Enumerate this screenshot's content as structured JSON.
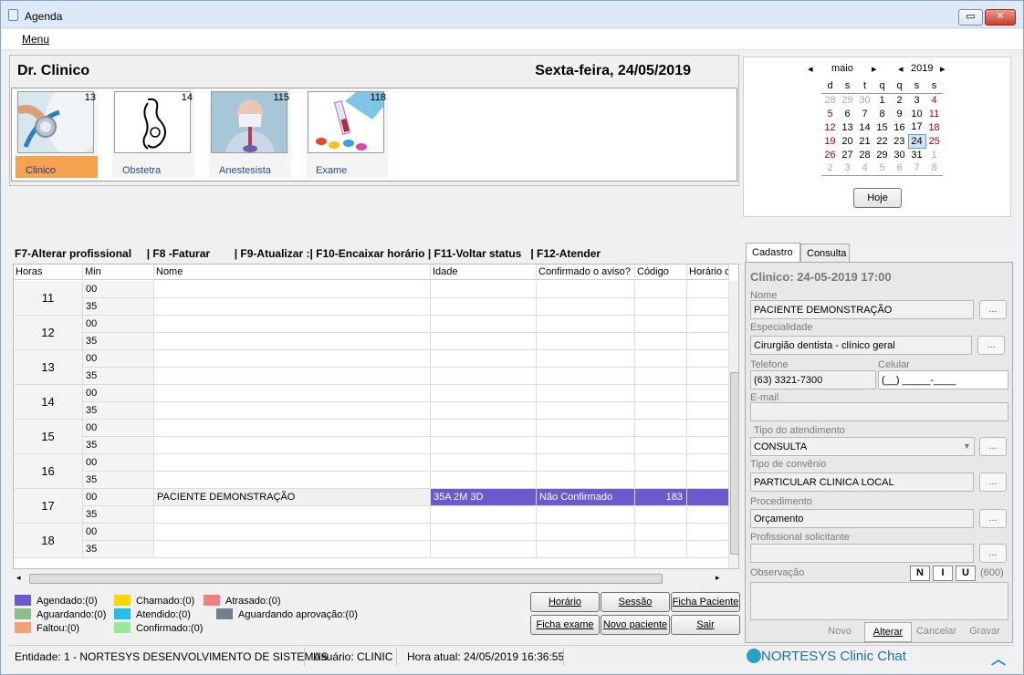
{
  "window": {
    "title": "Agenda",
    "min_glyph": "▭",
    "close_glyph": "✕"
  },
  "menu": {
    "label": "Menu"
  },
  "header": {
    "doctor": "Dr. Clinico",
    "date": "Sexta-feira, 24/05/2019"
  },
  "specialties": [
    {
      "label": "Clinico",
      "count": "13",
      "icon": "stethoscope-icon",
      "selected": true
    },
    {
      "label": "Obstetra",
      "count": "14",
      "icon": "pregnancy-icon",
      "selected": false
    },
    {
      "label": "Anestesista",
      "count": "115",
      "icon": "anesthetist-icon",
      "selected": false
    },
    {
      "label": "Exame",
      "count": "118",
      "icon": "blood-sample-icon",
      "selected": false
    }
  ],
  "calendar": {
    "month": "maio",
    "year": "2019",
    "weekdays": [
      "d",
      "s",
      "t",
      "q",
      "q",
      "s",
      "s"
    ],
    "weeks": [
      [
        "28",
        "29",
        "30",
        "1",
        "2",
        "3",
        "4"
      ],
      [
        "5",
        "6",
        "7",
        "8",
        "9",
        "10",
        "11"
      ],
      [
        "12",
        "13",
        "14",
        "15",
        "16",
        "17",
        "18"
      ],
      [
        "19",
        "20",
        "21",
        "22",
        "23",
        "24",
        "25"
      ],
      [
        "26",
        "27",
        "28",
        "29",
        "30",
        "31",
        "1"
      ],
      [
        "2",
        "3",
        "4",
        "5",
        "6",
        "7",
        "8"
      ]
    ],
    "today_label": "Hoje"
  },
  "shortcuts": "F7-Alterar profissional     | F8 -Faturar        | F9-Atualizar :| F10-Encaixar horário | F11-Voltar status   | F12-Atender",
  "grid": {
    "columns": [
      "Horas",
      "Min",
      "Nome",
      "Idade",
      "Confirmado o aviso?",
      "Código",
      "Horário c"
    ],
    "hours": [
      "11",
      "12",
      "13",
      "14",
      "15",
      "16",
      "17",
      "18"
    ],
    "minutes": [
      "00",
      "35"
    ],
    "appointment": {
      "hour": "17",
      "min": "00",
      "nome": "PACIENTE DEMONSTRAÇÃO",
      "idade": "35A 2M 3D",
      "confirmado": "Não Confirmado",
      "codigo": "183"
    }
  },
  "legend": [
    {
      "label": "Agendado:(0)",
      "color": "#6a5acd"
    },
    {
      "label": "Aguardando:(0)",
      "color": "#8fbc8f"
    },
    {
      "label": "Faltou:(0)",
      "color": "#f4a07a"
    },
    {
      "label": "Chamado:(0)",
      "color": "#ffd700"
    },
    {
      "label": "Atendido:(0)",
      "color": "#1ec0f0"
    },
    {
      "label": "Confirmado:(0)",
      "color": "#98e898"
    },
    {
      "label": "Atrasado:(0)",
      "color": "#f08080"
    },
    {
      "label": "Aguardando aprovação:(0)",
      "color": "#708090"
    }
  ],
  "buttons": {
    "horario": "Horário",
    "sessao": "Sessão",
    "ficha_paciente": "Ficha Paciente",
    "ficha_exame": "Ficha exame",
    "novo_paciente": "Novo paciente",
    "sair": "Sair"
  },
  "tabs": {
    "cadastro": "Cadastro",
    "consulta": "Consulta"
  },
  "form": {
    "heading": "Clinico: 24-05-2019 17:00",
    "nome_label": "Nome",
    "nome": "PACIENTE DEMONSTRAÇÃO",
    "especialidade_label": "Especialidade",
    "especialidade": "Cirurgião dentista - clínico geral",
    "telefone_label": "Telefone",
    "telefone": "(63) 3321-7300",
    "celular_label": "Celular",
    "celular": "(__) _____-____",
    "email_label": "E-mail",
    "email": "",
    "tipo_atendimento_label": "Tipo do atendimento",
    "tipo_atendimento": "CONSULTA",
    "tipo_convenio_label": "Tipo de convênio",
    "tipo_convenio": "PARTICULAR CLINICA LOCAL",
    "procedimento_label": "Procedimento",
    "procedimento": "Orçamento",
    "prof_solicitante_label": "Profissional solicitante",
    "prof_solicitante": "",
    "observacao_label": "Observação",
    "obs_count": "(600)",
    "fmt_n": "N",
    "fmt_i": "I",
    "fmt_u": "U",
    "dots": "...",
    "novo": "Novo",
    "alterar": "Alterar",
    "cancelar": "Cancelar",
    "gravar": "Gravar"
  },
  "status": {
    "entidade": "Entidade: 1 - NORTESYS DESENVOLVIMENTO DE SISTEMAS",
    "usuario": "Usuário: CLINIC",
    "hora": "Hora atual: 24/05/2019 16:36:55",
    "chat": "NORTESYS Clinic Chat"
  }
}
